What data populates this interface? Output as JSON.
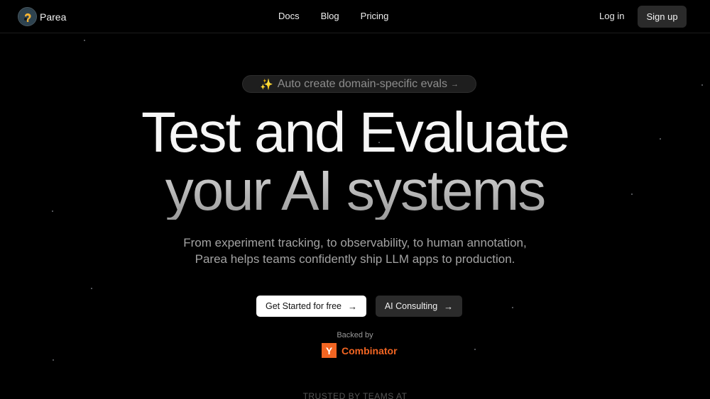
{
  "brand": {
    "name": "Parea",
    "logo_icon": "parea-logo-icon"
  },
  "nav": {
    "links": [
      {
        "label": "Docs"
      },
      {
        "label": "Blog"
      },
      {
        "label": "Pricing"
      }
    ],
    "login_label": "Log in",
    "signup_label": "Sign up"
  },
  "hero": {
    "announcement": {
      "sparkle": "✨",
      "text": "Auto create domain-specific evals",
      "arrow": "→"
    },
    "headline_line1": "Test and Evaluate",
    "headline_line2": "your AI systems",
    "subtitle_line1": "From experiment tracking, to observability, to human annotation,",
    "subtitle_line2": "Parea helps teams confidently ship LLM apps to production.",
    "primary_cta": {
      "label": "Get Started for free",
      "arrow": "→"
    },
    "secondary_cta": {
      "label": "AI Consulting",
      "arrow": "→"
    },
    "backed_by": "Backed by",
    "yc": {
      "letter": "Y",
      "name": "Combinator",
      "color": "#f26522"
    },
    "trusted_label": "TRUSTED BY TEAMS AT"
  },
  "colors": {
    "background": "#000000",
    "primary_button": "#ffffff",
    "secondary_button": "#2b2b2b",
    "accent_orange": "#f26522"
  }
}
